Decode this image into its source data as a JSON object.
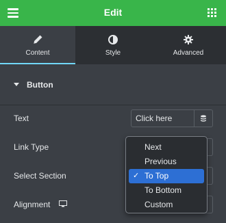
{
  "header": {
    "title": "Edit"
  },
  "tabs": [
    {
      "label": "Content",
      "icon": "pencil-icon",
      "active": true
    },
    {
      "label": "Style",
      "icon": "half-circle-icon",
      "active": false
    },
    {
      "label": "Advanced",
      "icon": "gear-icon",
      "active": false
    }
  ],
  "section": {
    "title": "Button",
    "expanded": true
  },
  "controls": {
    "text_label": "Text",
    "text_value": "Click here",
    "link_type_label": "Link Type",
    "select_section_label": "Select Section",
    "alignment_label": "Alignment"
  },
  "dropdown": {
    "options": [
      "Next",
      "Previous",
      "To Top",
      "To Bottom",
      "Custom"
    ],
    "selected": "To Top",
    "check_glyph": "✓"
  },
  "colors": {
    "header_bg": "#39b54a",
    "panel_bg": "#3b3f45",
    "tabs_bg": "#2c2f33",
    "active_tab_underline": "#71d7f7",
    "selection": "#2d6fd4"
  }
}
